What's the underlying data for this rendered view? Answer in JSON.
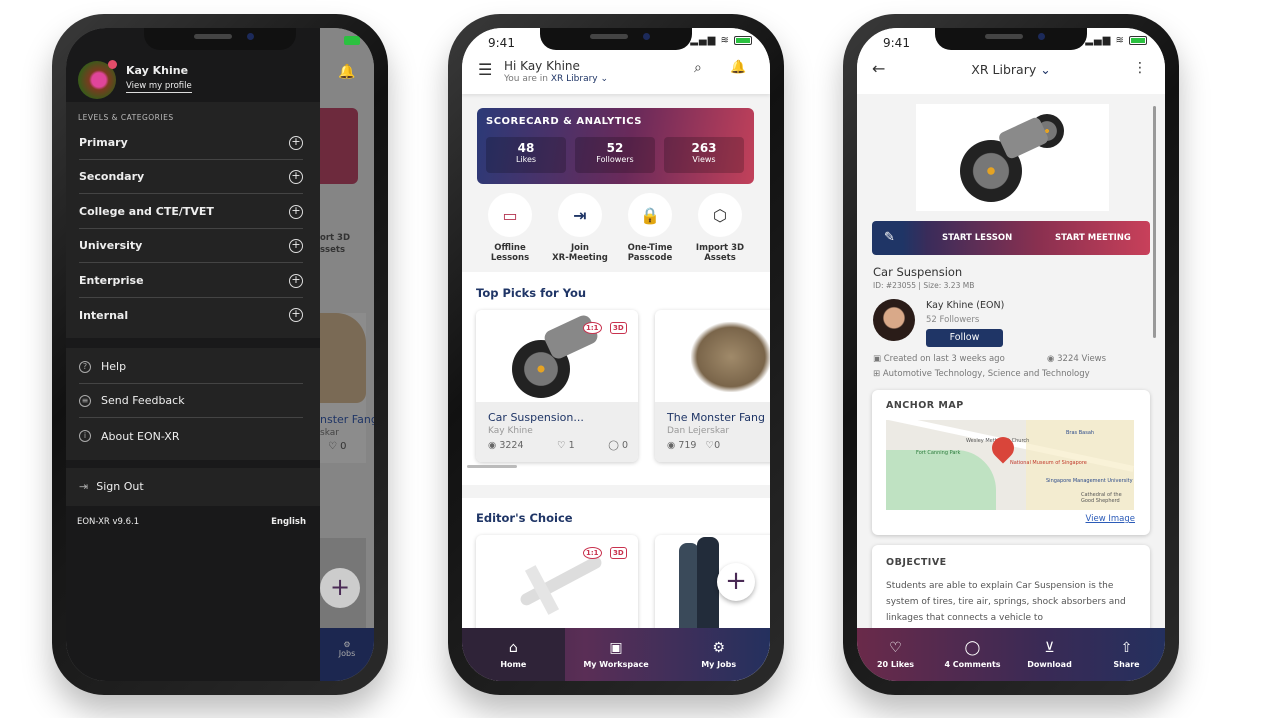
{
  "status": {
    "time": "9:41"
  },
  "drawer": {
    "user_name": "Kay Khine",
    "profile_link": "View my profile",
    "section_title": "LEVELS & CATEGORIES",
    "categories": [
      "Primary",
      "Secondary",
      "College and CTE/TVET",
      "University",
      "Enterprise",
      "Internal"
    ],
    "links": [
      {
        "label": "Help",
        "icon": "help-icon"
      },
      {
        "label": "Send Feedback",
        "icon": "feedback-icon"
      },
      {
        "label": "About EON-XR",
        "icon": "info-icon"
      }
    ],
    "sign_out": "Sign Out",
    "version": "EON-XR v9.6.1",
    "language": "English",
    "behind": {
      "import_label_1": "ort 3D",
      "import_label_2": "ssets",
      "card_title": "nster Fang",
      "card_author": "skar",
      "card_likes": "0",
      "nav_jobs": "Jobs"
    }
  },
  "home": {
    "greeting": "Hi Kay Khine",
    "location_prefix": "You are in",
    "location": "XR Library",
    "scorecard": {
      "title": "SCORECARD & ANALYTICS",
      "stats": [
        {
          "value": "48",
          "label": "Likes"
        },
        {
          "value": "52",
          "label": "Followers"
        },
        {
          "value": "263",
          "label": "Views"
        }
      ]
    },
    "quick_actions": [
      {
        "l1": "Offline",
        "l2": "Lessons"
      },
      {
        "l1": "Join",
        "l2": "XR-Meeting"
      },
      {
        "l1": "One-Time",
        "l2": "Passcode"
      },
      {
        "l1": "Import 3D",
        "l2": "Assets"
      }
    ],
    "top_picks_title": "Top Picks for You",
    "top_picks": [
      {
        "title": "Car Suspension...",
        "author": "Kay Khine",
        "views": "3224",
        "likes": "1",
        "comments": "0",
        "badge_scale": "1:1",
        "badge_3d": "3D"
      },
      {
        "title": "The Monster Fang",
        "author": "Dan Lejerskar",
        "views": "719",
        "likes": "0",
        "comments": ""
      }
    ],
    "editors_title": "Editor's Choice",
    "editors_badges": {
      "scale": "1:1",
      "type": "3D"
    },
    "nav": [
      "Home",
      "My Workspace",
      "My Jobs"
    ]
  },
  "detail": {
    "title": "XR Library",
    "start_lesson": "START LESSON",
    "start_meeting": "START MEETING",
    "name": "Car Suspension",
    "meta": "ID: #23055 | Size: 3.23 MB",
    "author": "Kay Khine (EON)",
    "followers": "52 Followers",
    "follow": "Follow",
    "created": "Created on last 3 weeks ago",
    "views": "3224 Views",
    "categories": "Automotive Technology, Science and Technology",
    "anchor_title": "ANCHOR MAP",
    "view_image": "View Image",
    "map_labels": [
      "National Museum of Singapore",
      "Singapore Management University",
      "Fort Canning Park",
      "Cathedral of the Good Shepherd",
      "Wesley Methodist Church",
      "Bras Basah"
    ],
    "objective_title": "OBJECTIVE",
    "objective_text": "Students are able to explain Car Suspension is the system of tires, tire air, springs, shock absorbers and linkages that connects a vehicle to",
    "actions": [
      "20 Likes",
      "4 Comments",
      "Download",
      "Share"
    ]
  },
  "colors": {
    "navy": "#1f3566",
    "crimson": "#c8324e",
    "drawer": "#19191a"
  }
}
